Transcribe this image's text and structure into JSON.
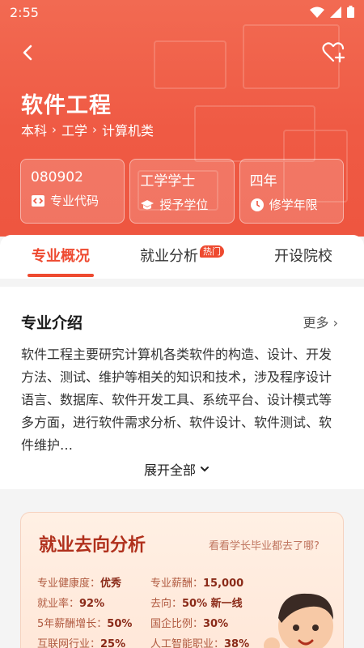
{
  "status": {
    "time": "2:55"
  },
  "header": {
    "title": "软件工程",
    "breadcrumb": [
      "本科",
      "工学",
      "计算机类"
    ]
  },
  "cards": [
    {
      "value": "080902",
      "label": "专业代码",
      "icon": "code-icon"
    },
    {
      "value": "工学学士",
      "label": "授予学位",
      "icon": "graduation-cap-icon"
    },
    {
      "value": "四年",
      "label": "修学年限",
      "icon": "clock-icon"
    }
  ],
  "tabs": [
    {
      "label": "专业概况",
      "active": true
    },
    {
      "label": "就业分析",
      "badge": "热门"
    },
    {
      "label": "开设院校"
    }
  ],
  "intro": {
    "heading": "专业介绍",
    "more": "更多",
    "text": "软件工程主要研究计算机各类软件的构造、设计、开发方法、测试、维护等相关的知识和技术，涉及程序设计语言、数据库、软件开发工具、系统平台、设计模式等多方面，进行软件需求分析、软件设计、软件测试、软件维护…",
    "expand": "展开全部"
  },
  "employment": {
    "title": "就业去向分析",
    "link": "看看学长毕业都去了哪?",
    "stats": [
      {
        "label": "专业健康度：",
        "value": "优秀"
      },
      {
        "label": "专业薪酬：",
        "value": "15,000"
      },
      {
        "label": "就业率：",
        "value": "92%"
      },
      {
        "label": "去向：",
        "value": "50% 新一线"
      },
      {
        "label": "5年薪酬增长：",
        "value": "50%"
      },
      {
        "label": "国企比例：",
        "value": "30%"
      },
      {
        "label": "互联网行业：",
        "value": "25%"
      },
      {
        "label": "人工智能职业：",
        "value": "38%"
      }
    ]
  }
}
